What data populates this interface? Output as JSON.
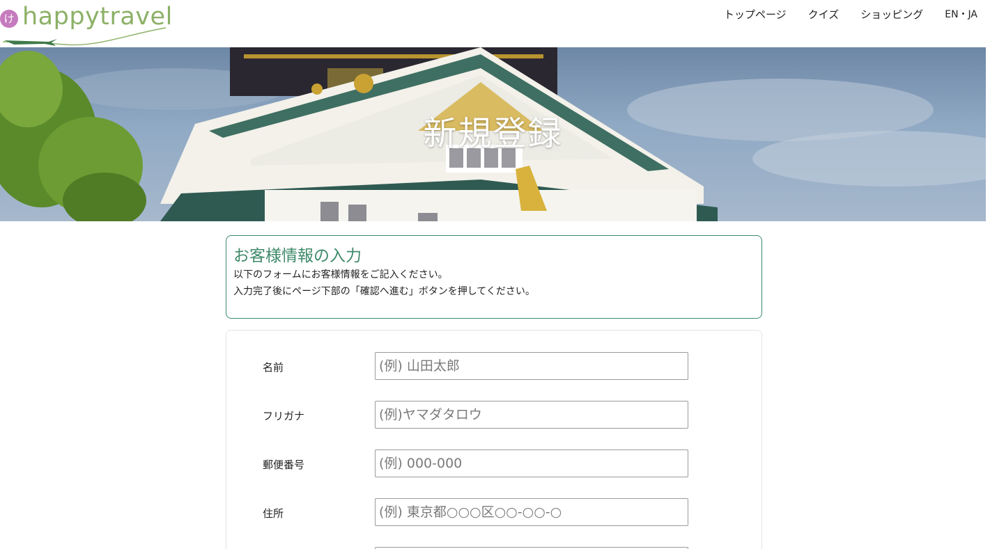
{
  "header": {
    "logo_badge": "け",
    "logo_text": "happytravel",
    "nav": [
      "トップページ",
      "クイズ",
      "ショッピング",
      "EN・JA"
    ]
  },
  "hero": {
    "title": "新規登録"
  },
  "intro": {
    "title": "お客様情報の入力",
    "line1": "以下のフォームにお客様情報をご記入ください。",
    "line2": "入力完了後にページ下部の「確認へ進む」ボタンを押してください。"
  },
  "form": {
    "fields": [
      {
        "label": "名前",
        "placeholder": "(例) 山田太郎"
      },
      {
        "label": "フリガナ",
        "placeholder": "(例)ヤマダタロウ"
      },
      {
        "label": "郵便番号",
        "placeholder": "(例) 000-000"
      },
      {
        "label": "住所",
        "placeholder": "(例) 東京都○○○区○○-○○-○"
      },
      {
        "label": "",
        "placeholder": ""
      }
    ]
  },
  "colors": {
    "accent_green": "#3f8a6b",
    "logo_green": "#8cb167",
    "logo_badge": "#c57bbd"
  }
}
